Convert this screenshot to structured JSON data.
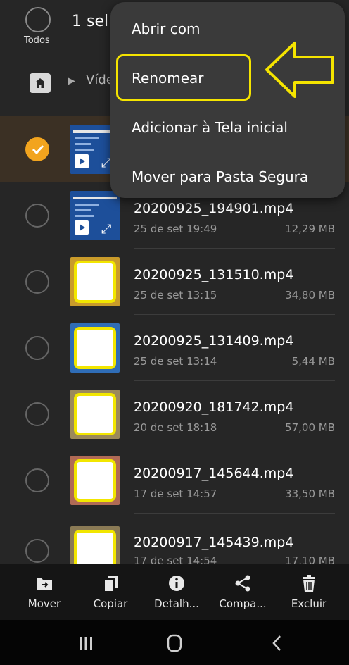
{
  "header": {
    "select_all_label": "Todos",
    "selection_count": "1 sel",
    "breadcrumb": "Víde"
  },
  "menu": {
    "items": [
      "Abrir com",
      "Renomear",
      "Adicionar à Tela inicial",
      "Mover para Pasta Segura"
    ],
    "highlight_color": "#f5e400"
  },
  "files": [
    {
      "name": "",
      "date": "",
      "size": "",
      "selected": true
    },
    {
      "name": "20200925_194901.mp4",
      "date": "25 de set 19:49",
      "size": "12,29 MB",
      "selected": false
    },
    {
      "name": "20200925_131510.mp4",
      "date": "25 de set 13:15",
      "size": "34,80 MB",
      "selected": false
    },
    {
      "name": "20200925_131409.mp4",
      "date": "25 de set 13:14",
      "size": "5,44 MB",
      "selected": false
    },
    {
      "name": "20200920_181742.mp4",
      "date": "20 de set 18:18",
      "size": "57,00 MB",
      "selected": false
    },
    {
      "name": "20200917_145644.mp4",
      "date": "17 de set 14:57",
      "size": "33,50 MB",
      "selected": false
    },
    {
      "name": "20200917_145439.mp4",
      "date": "17 de set 14:54",
      "size": "17,10 MB",
      "selected": false
    }
  ],
  "actions": [
    {
      "label": "Mover",
      "icon": "move-icon"
    },
    {
      "label": "Copiar",
      "icon": "copy-icon"
    },
    {
      "label": "Detalh...",
      "icon": "info-icon"
    },
    {
      "label": "Compa...",
      "icon": "share-icon"
    },
    {
      "label": "Excluir",
      "icon": "trash-icon"
    }
  ],
  "colors": {
    "accent": "#f2a41e",
    "selected_row": "#3b3024",
    "background": "#262626"
  }
}
